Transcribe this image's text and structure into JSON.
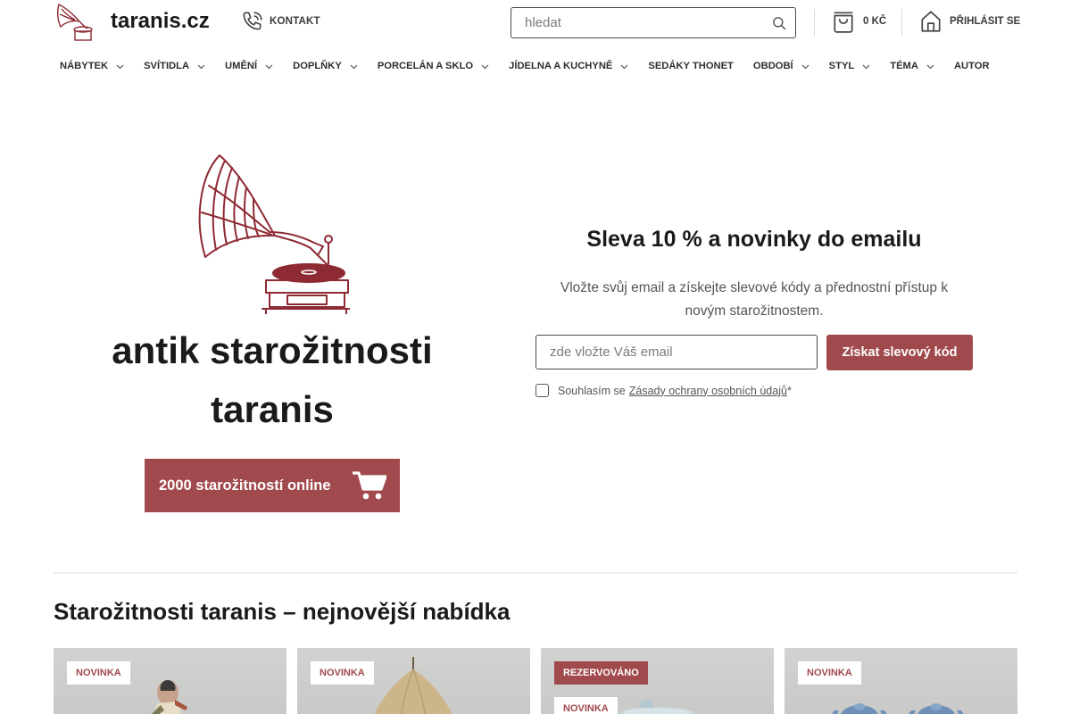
{
  "header": {
    "site_name": "taranis.cz",
    "contact_label": "KONTAKT",
    "search_placeholder": "hledat",
    "cart_amount": "0 KČ",
    "login_label": "PŘIHLÁSIT SE"
  },
  "nav": {
    "items": [
      {
        "label": "NÁBYTEK",
        "has_dropdown": true
      },
      {
        "label": "SVÍTIDLA",
        "has_dropdown": true
      },
      {
        "label": "UMĚNÍ",
        "has_dropdown": true
      },
      {
        "label": "DOPLŇKY",
        "has_dropdown": true
      },
      {
        "label": "PORCELÁN A SKLO",
        "has_dropdown": true
      },
      {
        "label": "JÍDELNA A KUCHYNĚ",
        "has_dropdown": true
      },
      {
        "label": "SEDÁKY THONET",
        "has_dropdown": false
      },
      {
        "label": "OBDOBÍ",
        "has_dropdown": true
      },
      {
        "label": "STYL",
        "has_dropdown": true
      },
      {
        "label": "TÉMA",
        "has_dropdown": true
      },
      {
        "label": "AUTOR",
        "has_dropdown": false
      }
    ]
  },
  "hero": {
    "title": "antik starožitnosti taranis",
    "cta_label": "2000 starožitností online"
  },
  "newsletter": {
    "title": "Sleva 10 % a novinky do emailu",
    "description": "Vložte svůj email a získejte slevové kódy a přednostní přístup k novým starožitnostem.",
    "email_placeholder": "zde vložte Váš email",
    "submit_label": "Získat slevový kód",
    "consent_prefix": "Souhlasím se",
    "consent_link": "Zásady ochrany osobních údajů",
    "consent_required": "*"
  },
  "listing": {
    "title": "Starožitnosti taranis – nejnovější nabídka",
    "cards": [
      {
        "badges": [
          "NOVINKA"
        ]
      },
      {
        "badges": [
          "NOVINKA"
        ]
      },
      {
        "badges": [
          "REZERVOVÁNO",
          "NOVINKA"
        ]
      },
      {
        "badges": [
          "NOVINKA"
        ]
      }
    ]
  },
  "colors": {
    "accent": "#a14a4d",
    "text": "#1a1a1a",
    "muted": "#555555",
    "logo": "#8e2a33"
  },
  "icons": {
    "phone": "phone-icon",
    "search": "search-icon",
    "cart": "shopping-bag-icon",
    "login": "home-icon",
    "chevron": "chevron-down-icon",
    "cta_cart": "cart-icon"
  }
}
